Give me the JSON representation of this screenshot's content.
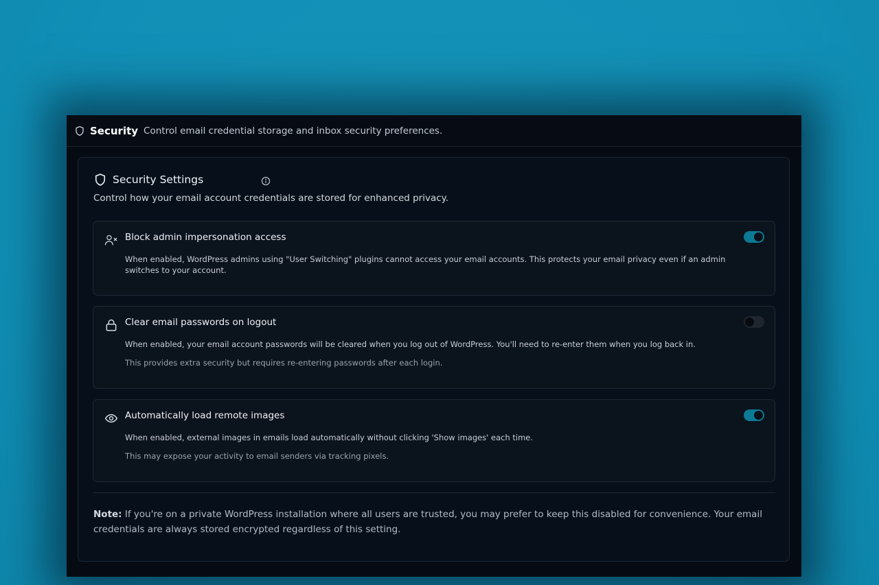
{
  "header": {
    "title": "Security",
    "subtitle": "Control email credential storage and inbox security preferences.",
    "icon": "shield-icon"
  },
  "card": {
    "title": "Security Settings",
    "description": "Control how your email account credentials are stored for enhanced privacy."
  },
  "options": [
    {
      "icon": "user-x-icon",
      "title": "Block admin impersonation access",
      "description": "When enabled, WordPress admins using \"User Switching\" plugins cannot access your email accounts. This protects your email privacy even if an admin switches to your account.",
      "note": "",
      "enabled": true
    },
    {
      "icon": "lock-icon",
      "title": "Clear email passwords on logout",
      "description": "When enabled, your email account passwords will be cleared when you log out of WordPress. You'll need to re-enter them when you log back in.",
      "note": "This provides extra security but requires re-entering passwords after each login.",
      "enabled": false
    },
    {
      "icon": "eye-icon",
      "title": "Automatically load remote images",
      "description": "When enabled, external images in emails load automatically without clicking 'Show images' each time.",
      "note": "This may expose your activity to email senders via tracking pixels.",
      "enabled": true
    }
  ],
  "note": {
    "label": "Note:",
    "text": " If you're on a private WordPress installation where all users are trusted, you may prefer to keep this disabled for convenience. Your email credentials are always stored encrypted regardless of this setting."
  },
  "colors": {
    "accent": "#0c7a96",
    "background": "#118fb6",
    "panel": "#060b13"
  }
}
